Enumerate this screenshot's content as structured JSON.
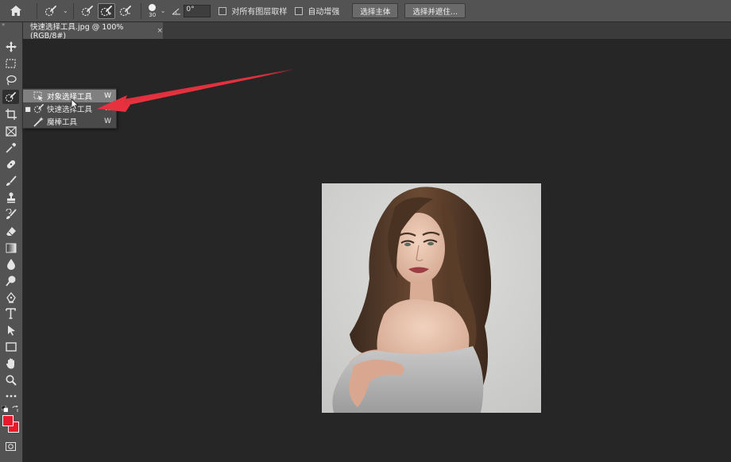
{
  "options_bar": {
    "brush_size": "30",
    "angle": "0°",
    "sample_all_layers_label": "对所有图层取样",
    "auto_enhance_label": "自动增强",
    "select_subject_label": "选择主体",
    "select_and_mask_label": "选择并遮住..."
  },
  "document_tab": {
    "title": "快速选择工具.jpg @ 100%(RGB/8#)",
    "close": "×"
  },
  "flyout": {
    "items": [
      {
        "label": "对象选择工具",
        "shortcut": "W",
        "selected": false,
        "highlighted": true
      },
      {
        "label": "快速选择工具",
        "shortcut": "W",
        "selected": true,
        "highlighted": false
      },
      {
        "label": "魔棒工具",
        "shortcut": "W",
        "selected": false,
        "highlighted": false
      }
    ]
  },
  "colors": {
    "foreground": "#e8192c",
    "background": "#e8192c",
    "annotation_arrow": "#e8313e"
  },
  "icons": {
    "home": "home-icon",
    "move": "move-icon",
    "marquee": "rectangular-marquee-icon",
    "lasso": "lasso-icon",
    "quick_select": "quick-selection-icon",
    "crop": "crop-icon",
    "frame": "frame-icon",
    "eyedropper": "eyedropper-icon",
    "healing": "healing-brush-icon",
    "brush": "brush-icon",
    "stamp": "clone-stamp-icon",
    "history_brush": "history-brush-icon",
    "eraser": "eraser-icon",
    "gradient": "gradient-icon",
    "blur": "blur-drop-icon",
    "dodge": "dodge-icon",
    "pen": "pen-icon",
    "type": "type-icon",
    "path_select": "path-selection-icon",
    "rectangle": "rectangle-shape-icon",
    "hand": "hand-icon",
    "zoom": "zoom-icon",
    "more": "more-tools-icon"
  }
}
